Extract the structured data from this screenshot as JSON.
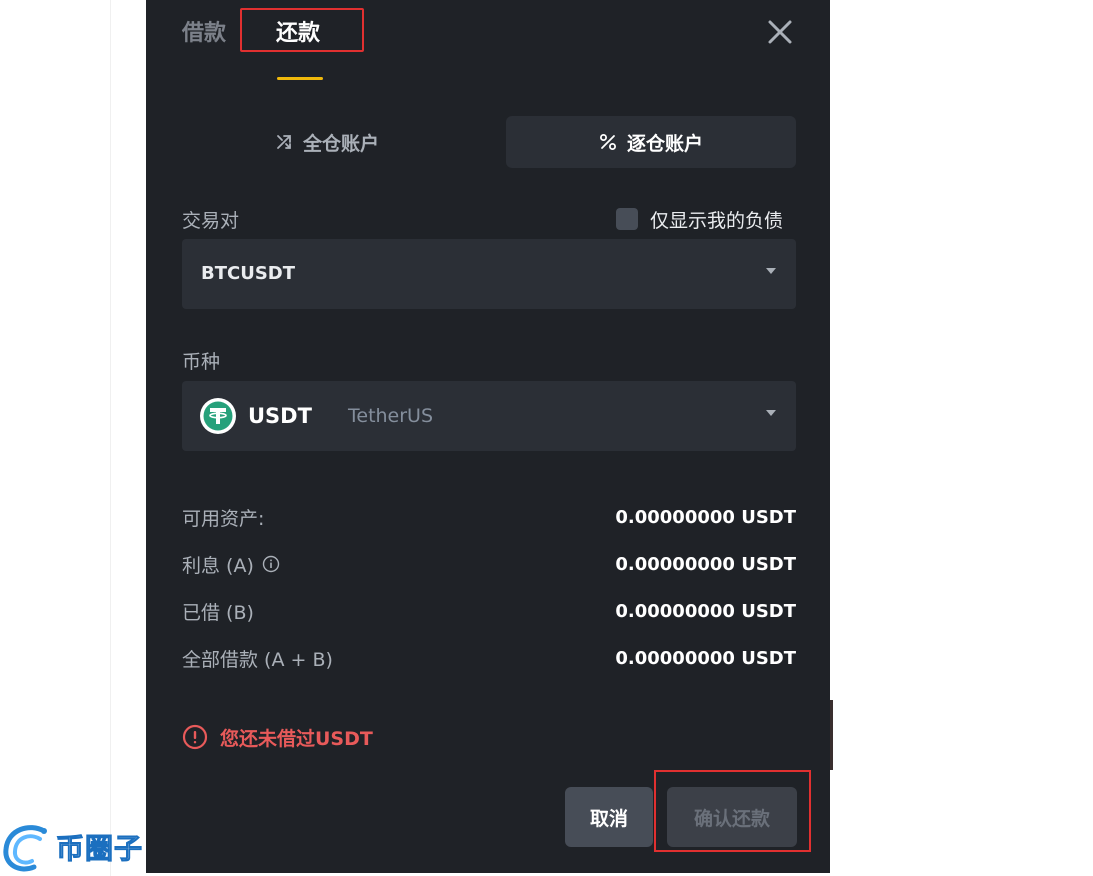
{
  "tabs": {
    "borrow": "借款",
    "repay": "还款"
  },
  "accounts": {
    "cross": "全仓账户",
    "isolated": "逐仓账户"
  },
  "pair": {
    "label": "交易对",
    "only_my_debt": "仅显示我的负债",
    "value": "BTCUSDT"
  },
  "coin": {
    "label": "币种",
    "symbol": "USDT",
    "name": "TetherUS"
  },
  "info": [
    {
      "key": "可用资产:",
      "value": "0.00000000 USDT"
    },
    {
      "key": "利息 (A)",
      "value": "0.00000000 USDT"
    },
    {
      "key": "已借 (B)",
      "value": "0.00000000 USDT"
    },
    {
      "key": "全部借款 (A + B)",
      "value": "0.00000000 USDT"
    }
  ],
  "warning": "您还未借过USDT",
  "buttons": {
    "cancel": "取消",
    "confirm": "确认还款"
  },
  "watermark": "币圈子",
  "colors": {
    "background": "#1f2227",
    "accent": "#f0b90b",
    "warning": "#e85a5a",
    "highlight": "#e03030",
    "tether": "#26a17b"
  }
}
